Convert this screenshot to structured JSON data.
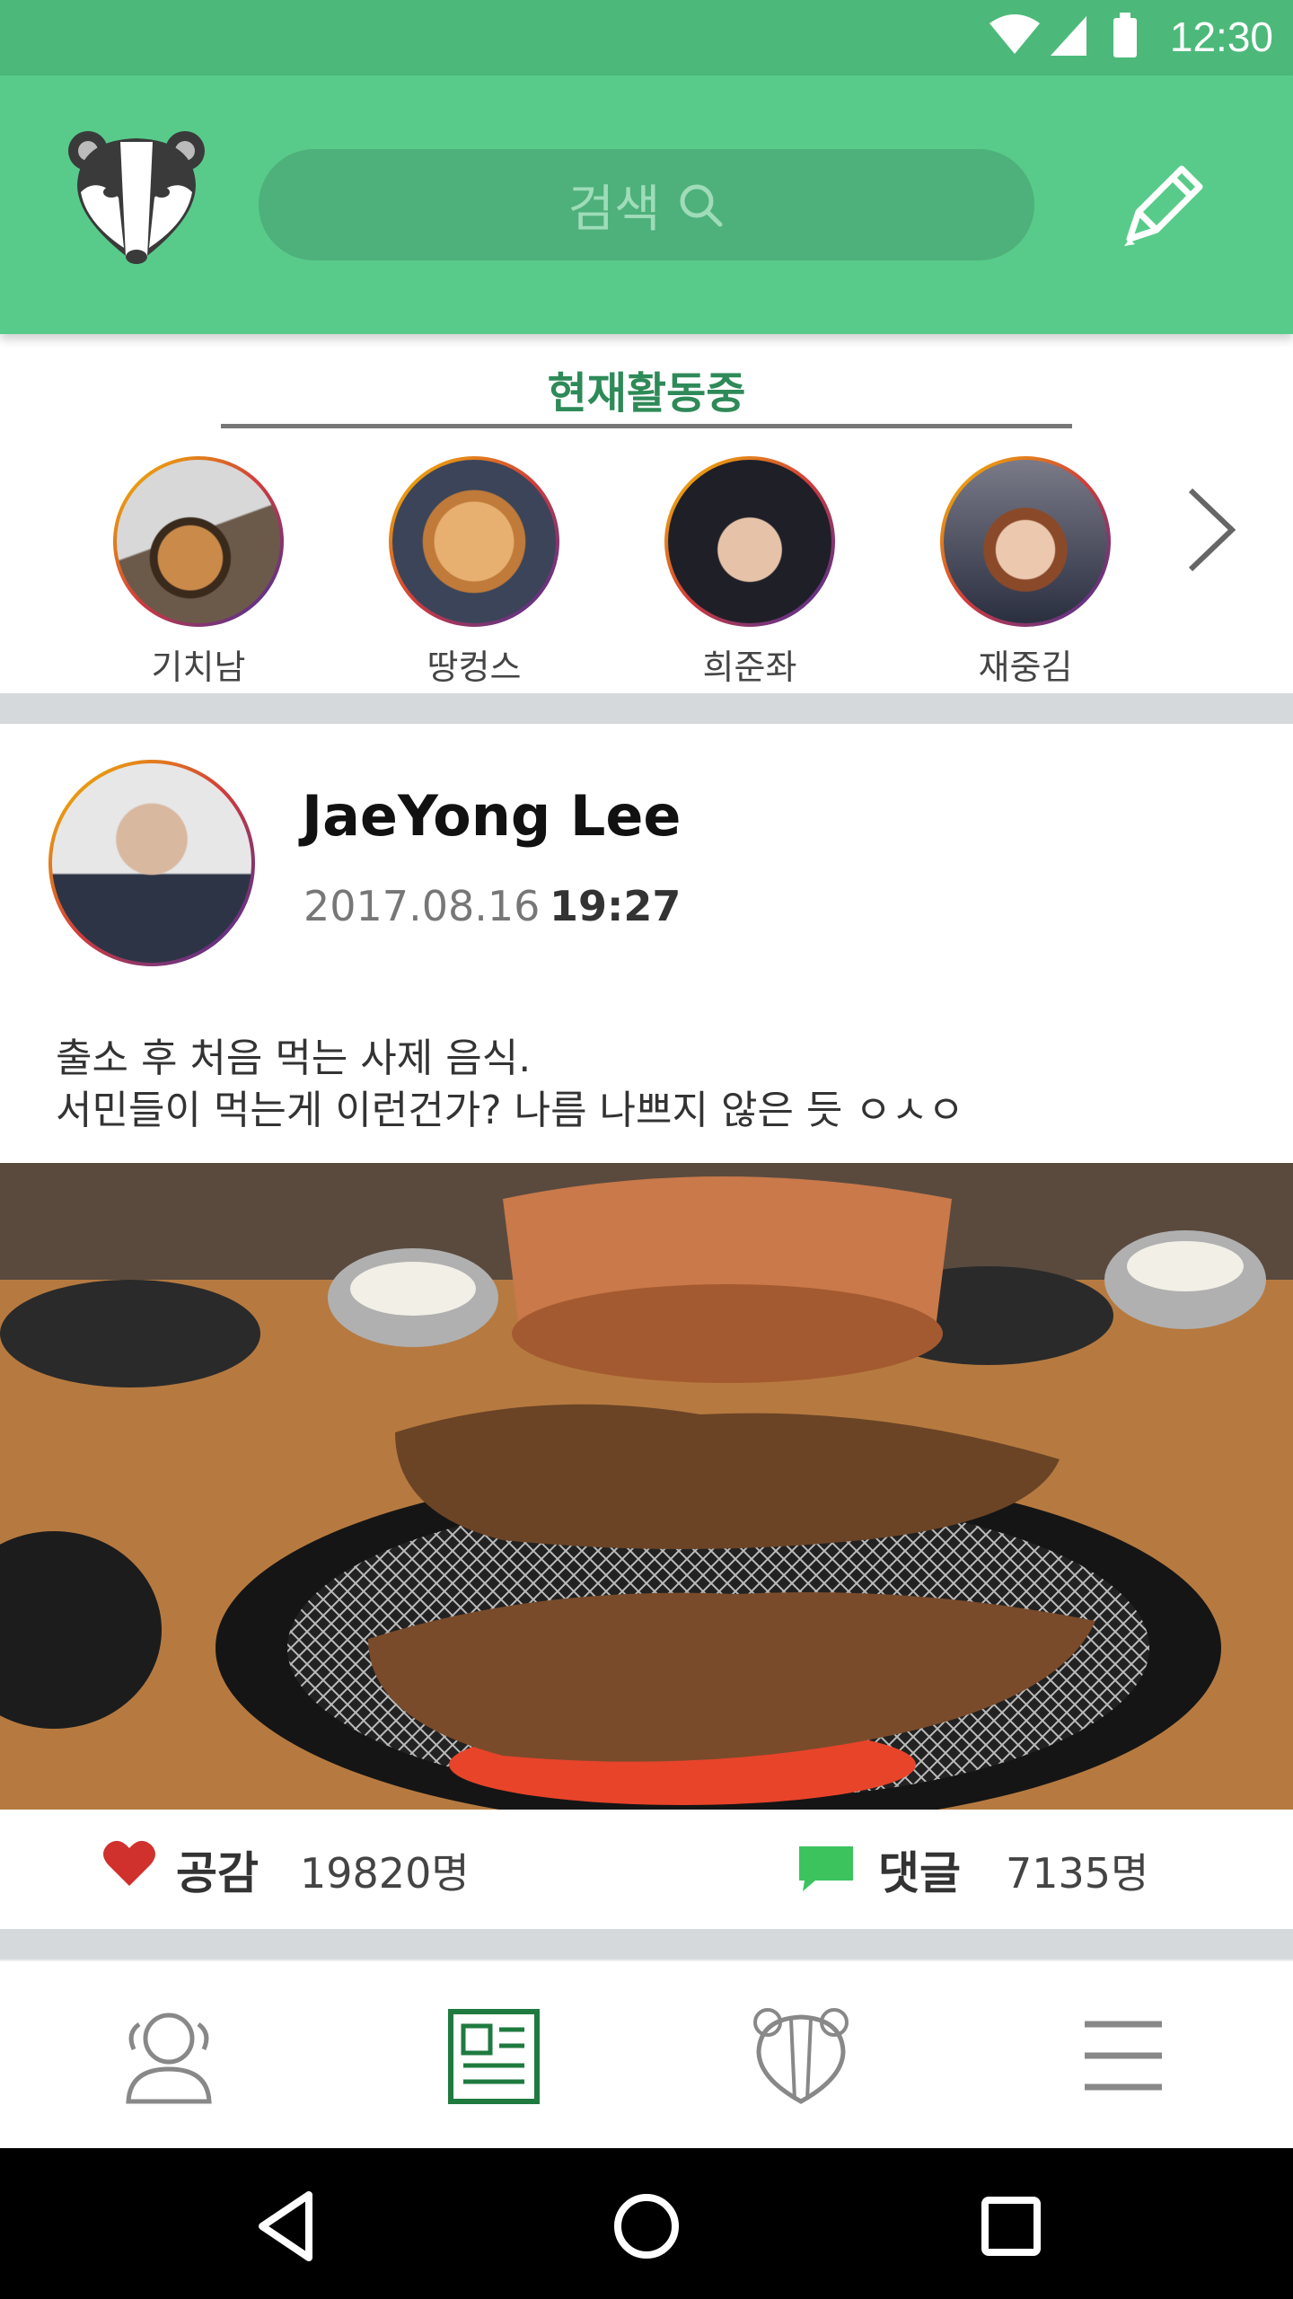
{
  "status_bar": {
    "time": "12:30"
  },
  "header": {
    "search_placeholder": "검색"
  },
  "active_now": {
    "title": "현재활동중",
    "friends": [
      {
        "name": "기치남"
      },
      {
        "name": "땅컹스"
      },
      {
        "name": "희준좌"
      },
      {
        "name": "재중김"
      }
    ]
  },
  "post": {
    "author": "JaeYong Lee",
    "date": "2017.08.16",
    "time": "19:27",
    "text_line1": "출소 후 처음 먹는 사제 음식.",
    "text_line2": "서민들이 먹는게 이런건가? 나름 나쁘지 않은 듯 ㅇㅅㅇ",
    "like_label": "공감",
    "like_count": "19820명",
    "comment_label": "댓글",
    "comment_count": "7135명"
  },
  "tabs": [
    {
      "icon": "friends-icon"
    },
    {
      "icon": "newsfeed-icon",
      "active": true
    },
    {
      "icon": "mascot-icon"
    },
    {
      "icon": "menu-icon"
    }
  ],
  "colors": {
    "status_bar": "#4cb97a",
    "header": "#58cb8a",
    "search_pill": "#4eb07a",
    "accent_text": "#2e8a58",
    "heart": "#d0312d",
    "comment": "#3cc35e",
    "active_tab": "#1f7a3f"
  }
}
